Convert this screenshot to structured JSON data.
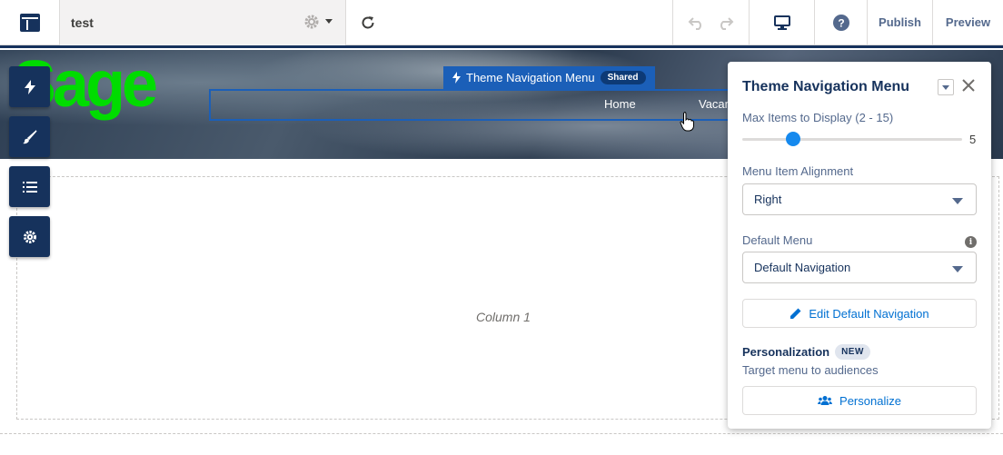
{
  "topbar": {
    "site_name": "test",
    "publish_label": "Publish",
    "preview_label": "Preview"
  },
  "hero": {
    "logo_text": "Sage",
    "nav_tag_label": "Theme Navigation Menu",
    "shared_label": "Shared",
    "nav_items": [
      "Home",
      "Vacan"
    ]
  },
  "canvas": {
    "column_label": "Column 1"
  },
  "panel": {
    "title": "Theme Navigation Menu",
    "max_items_label": "Max Items to Display (2 - 15)",
    "max_items_value": 5,
    "max_items_min": 2,
    "max_items_max": 15,
    "alignment_label": "Menu Item Alignment",
    "alignment_value": "Right",
    "default_menu_label": "Default Menu",
    "default_menu_value": "Default Navigation",
    "edit_button_label": "Edit Default Navigation",
    "personalization_label": "Personalization",
    "new_badge": "NEW",
    "personalization_sub": "Target menu to audiences",
    "personalize_button_label": "Personalize"
  },
  "colors": {
    "brand_navy": "#16325c",
    "link_blue": "#0070d2",
    "selection_blue": "#1b5fb8",
    "logo_green": "#00dc00"
  }
}
